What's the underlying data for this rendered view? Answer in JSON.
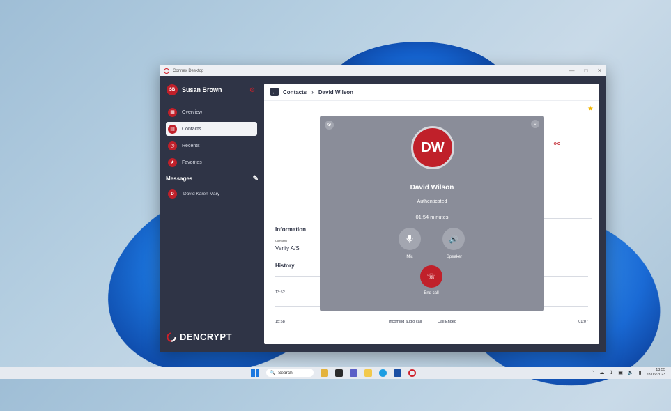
{
  "window": {
    "title": "Connex Desktop"
  },
  "user": {
    "initials": "SB",
    "name": "Susan Brown"
  },
  "nav": [
    {
      "label": "Overview",
      "icon": "grid-icon"
    },
    {
      "label": "Contacts",
      "icon": "contacts-icon"
    },
    {
      "label": "Recents",
      "icon": "clock-icon"
    },
    {
      "label": "Favorites",
      "icon": "star-icon"
    }
  ],
  "messages": {
    "heading": "Messages",
    "items": [
      {
        "initial": "D",
        "label": "David Karen Mary"
      }
    ]
  },
  "brand": {
    "name": "DENCRYPT"
  },
  "breadcrumb": {
    "section": "Contacts",
    "current": "David Wilson"
  },
  "info": {
    "heading": "Information",
    "company_label": "Company",
    "company_value": "Verify A/S"
  },
  "history": {
    "heading": "History",
    "rows": [
      {
        "time": "13:52",
        "type": "",
        "status": "",
        "duration": ""
      },
      {
        "time": "15:58",
        "type": "Incoming audio call",
        "status": "Call Ended",
        "duration": "01:07"
      }
    ]
  },
  "call": {
    "initials": "DW",
    "name": "David Wilson",
    "status": "Authenticated",
    "duration": "01:54 minutes",
    "mic_label": "Mic",
    "speaker_label": "Speaker",
    "end_label": "End call"
  },
  "taskbar": {
    "search_placeholder": "Search",
    "time": "13:55",
    "date": "28/06/2023"
  },
  "colors": {
    "accent": "#c0202a",
    "sidebar": "#2f3446",
    "overlay": "#8a8d99",
    "star": "#f2b705"
  }
}
